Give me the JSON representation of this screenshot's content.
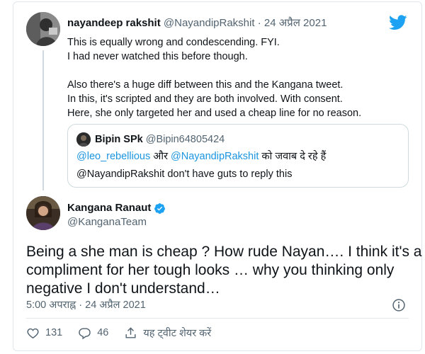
{
  "context_tweet": {
    "author_name": "nayandeep rakshit",
    "author_handle": "@NayandipRakshit",
    "separator": "·",
    "date": "24 अप्रैल 2021",
    "text_lines": [
      "This is equally wrong and condescending. FYI.",
      "I had never watched this before though.",
      "",
      "Also there's a huge diff between this and the Kangana tweet.",
      "In this, it's scripted and they are both involved. With consent.",
      "Here, she only targeted her and used a cheap line for no reason."
    ]
  },
  "quoted_tweet": {
    "author_name": "Bipin SPk",
    "author_handle": "@Bipin64805424",
    "line1_mention1": "@leo_rebellious",
    "line1_connector": " और ",
    "line1_mention2": "@NayandipRakshit",
    "line1_suffix": " को जवाब दे रहे हैं",
    "line2_mention": "@NayandipRakshit",
    "line2_text": " don't have guts to reply this"
  },
  "main_tweet": {
    "author_name": "Kangana Ranaut",
    "author_handle": "@KanganaTeam",
    "text_lines": [
      "Being a she man is cheap ? How rude Nayan…. I think it's a",
      "compliment for her tough looks … why you thinking only",
      "negative I don't understand…"
    ],
    "timestamp": "5:00 अपराह्न · 24 अप्रैल 2021"
  },
  "actions": {
    "like_count": "131",
    "reply_count": "46",
    "share_label": "यह ट्वीट शेयर करें"
  },
  "colors": {
    "brand": "#1da1f2",
    "mention": "#1b95e0",
    "muted": "#536471"
  },
  "icons": {
    "brand": "twitter-bird-icon",
    "verified": "verified-badge-icon",
    "info": "info-icon",
    "like": "heart-icon",
    "reply": "reply-icon",
    "share": "share-icon"
  }
}
